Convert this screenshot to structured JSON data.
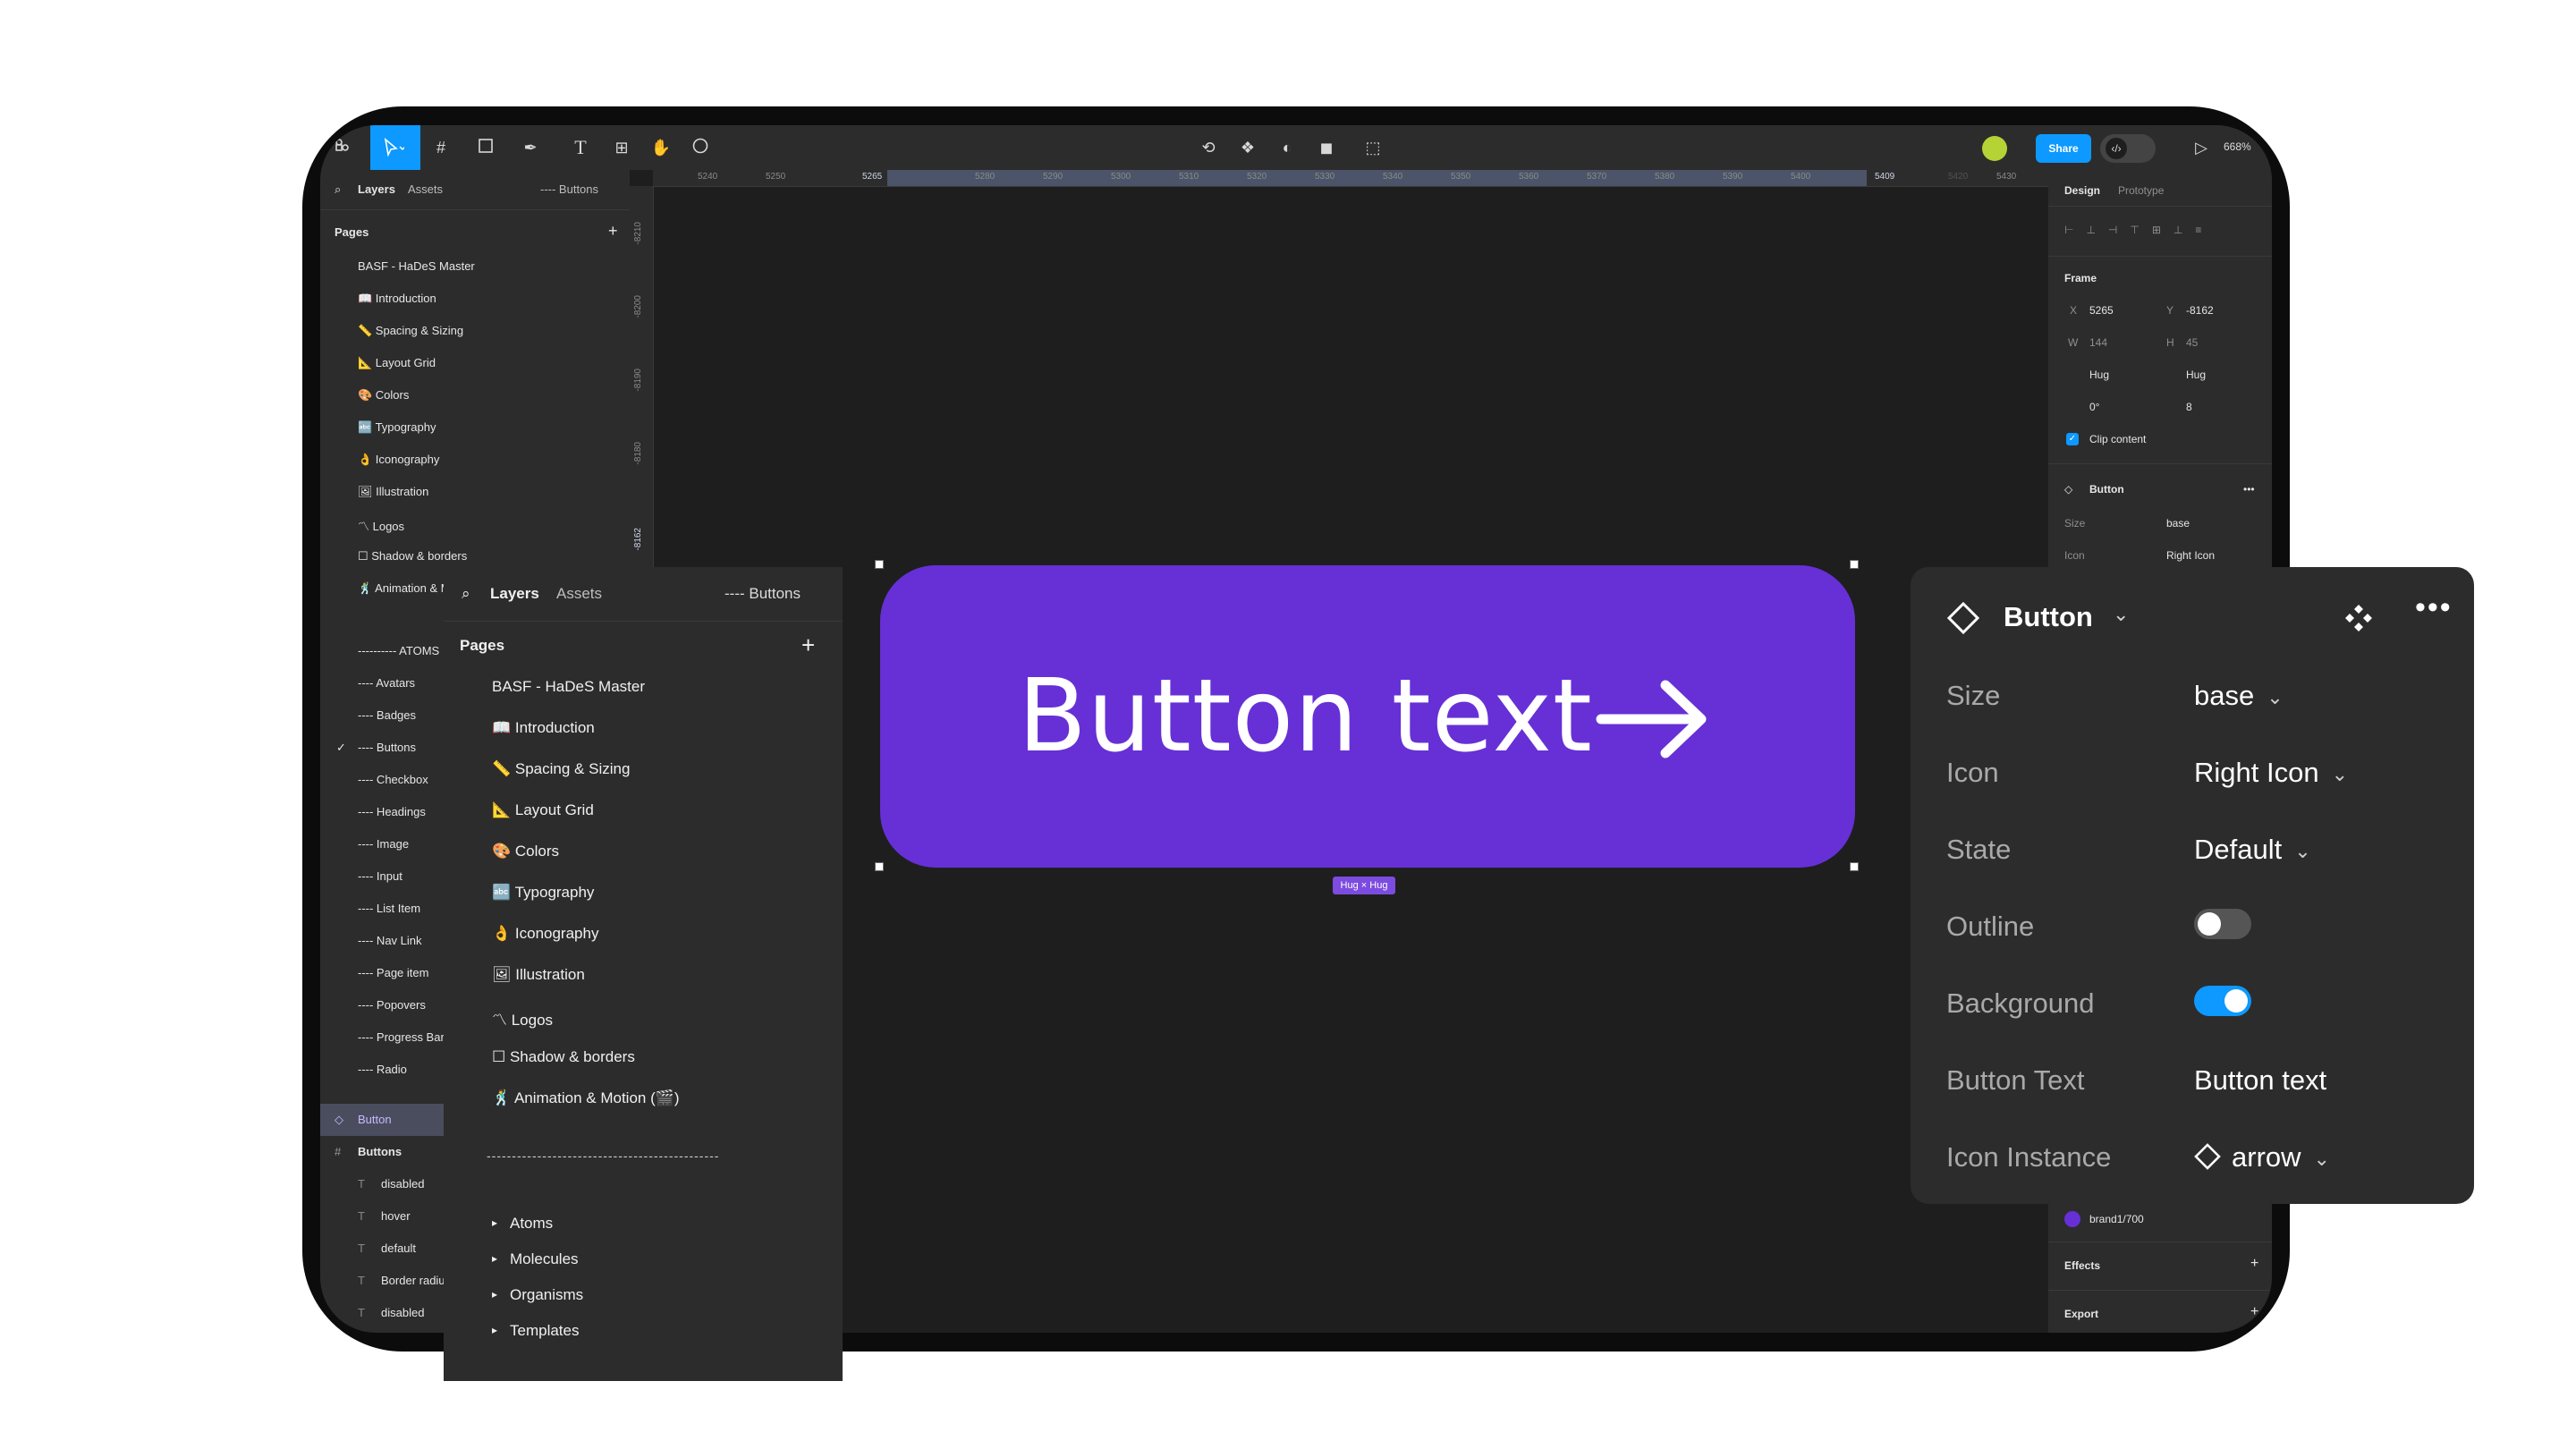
{
  "toolbar": {
    "share_label": "Share",
    "zoom_level": "668%",
    "accent_color": "#0d99ff"
  },
  "ruler": {
    "top_ticks": [
      "5240",
      "5250",
      "5265",
      "5280",
      "5290",
      "5300",
      "5310",
      "5320",
      "5330",
      "5340",
      "5350",
      "5360",
      "5370",
      "5380",
      "5390",
      "5400",
      "5409",
      "5420",
      "5430"
    ],
    "left_ticks": [
      "-8210",
      "-8200",
      "-8190",
      "-8180",
      "-8162"
    ]
  },
  "left_panel": {
    "tab_layers": "Layers",
    "tab_assets": "Assets",
    "current_page": "---- Buttons",
    "pages_heading": "Pages",
    "pages": [
      "BASF - HaDeS Master",
      "📖 Introduction",
      "📏 Spacing & Sizing",
      "📐 Layout Grid",
      "🎨 Colors",
      "🔤 Typography",
      "👌 Iconography",
      "🖼 Illustration",
      "〽 Logos",
      "☐ Shadow & borders",
      "🕺 Animation & Motion"
    ],
    "section_atoms": "---------- ATOMS",
    "atoms": [
      "---- Avatars",
      "---- Badges",
      "---- Buttons",
      "---- Checkbox",
      "---- Headings",
      "---- Image",
      "---- Input",
      "---- List Item",
      "---- Nav Link",
      "---- Page item",
      "---- Popovers",
      "---- Progress Bar",
      "---- Radio"
    ],
    "selected_layer": "Button",
    "frame_layer": "Buttons",
    "text_layers": [
      "disabled",
      "hover",
      "default",
      "Border radius",
      "disabled"
    ]
  },
  "right_panel": {
    "tab_design": "Design",
    "tab_prototype": "Prototype",
    "frame_label": "Frame",
    "x_label": "X",
    "x_value": "5265",
    "y_label": "Y",
    "y_value": "-8162",
    "w_label": "W",
    "w_value": "144",
    "h_label": "H",
    "h_value": "45",
    "hug_w": "Hug",
    "hug_h": "Hug",
    "rotation": "0°",
    "radius": "8",
    "clip_content": "Clip content",
    "component_name": "Button",
    "size_label": "Size",
    "size_value": "base",
    "icon_label": "Icon",
    "icon_value": "Right Icon",
    "fill_style": "brand1/700",
    "fill_color": "#6630d6",
    "effects_label": "Effects",
    "export_label": "Export"
  },
  "canvas": {
    "button_text": "Button text",
    "button_color": "#6630d6",
    "hug_badge": "Hug × Hug"
  },
  "zoom_layers": {
    "tab_layers": "Layers",
    "tab_assets": "Assets",
    "current_page": "---- Buttons",
    "pages_heading": "Pages",
    "pages": [
      "BASF - HaDeS Master",
      "📖 Introduction",
      "📏 Spacing & Sizing",
      "📐 Layout Grid",
      "🎨 Colors",
      "🔤 Typography",
      "👌 Iconography",
      "🖼 Illustration",
      "〽 Logos",
      "☐ Shadow & borders",
      "🕺 Animation & Motion (🎬)"
    ],
    "divider": "----------------------------------------------",
    "groups": [
      "Atoms",
      "Molecules",
      "Organisms",
      "Templates"
    ]
  },
  "zoom_props": {
    "title": "Button",
    "rows": [
      {
        "label": "Size",
        "value": "base"
      },
      {
        "label": "Icon",
        "value": "Right Icon"
      },
      {
        "label": "State",
        "value": "Default"
      },
      {
        "label": "Outline",
        "toggle": false
      },
      {
        "label": "Background",
        "toggle": true
      },
      {
        "label": "Button Text",
        "value": "Button text"
      },
      {
        "label": "Icon Instance",
        "value": "arrow"
      }
    ]
  }
}
